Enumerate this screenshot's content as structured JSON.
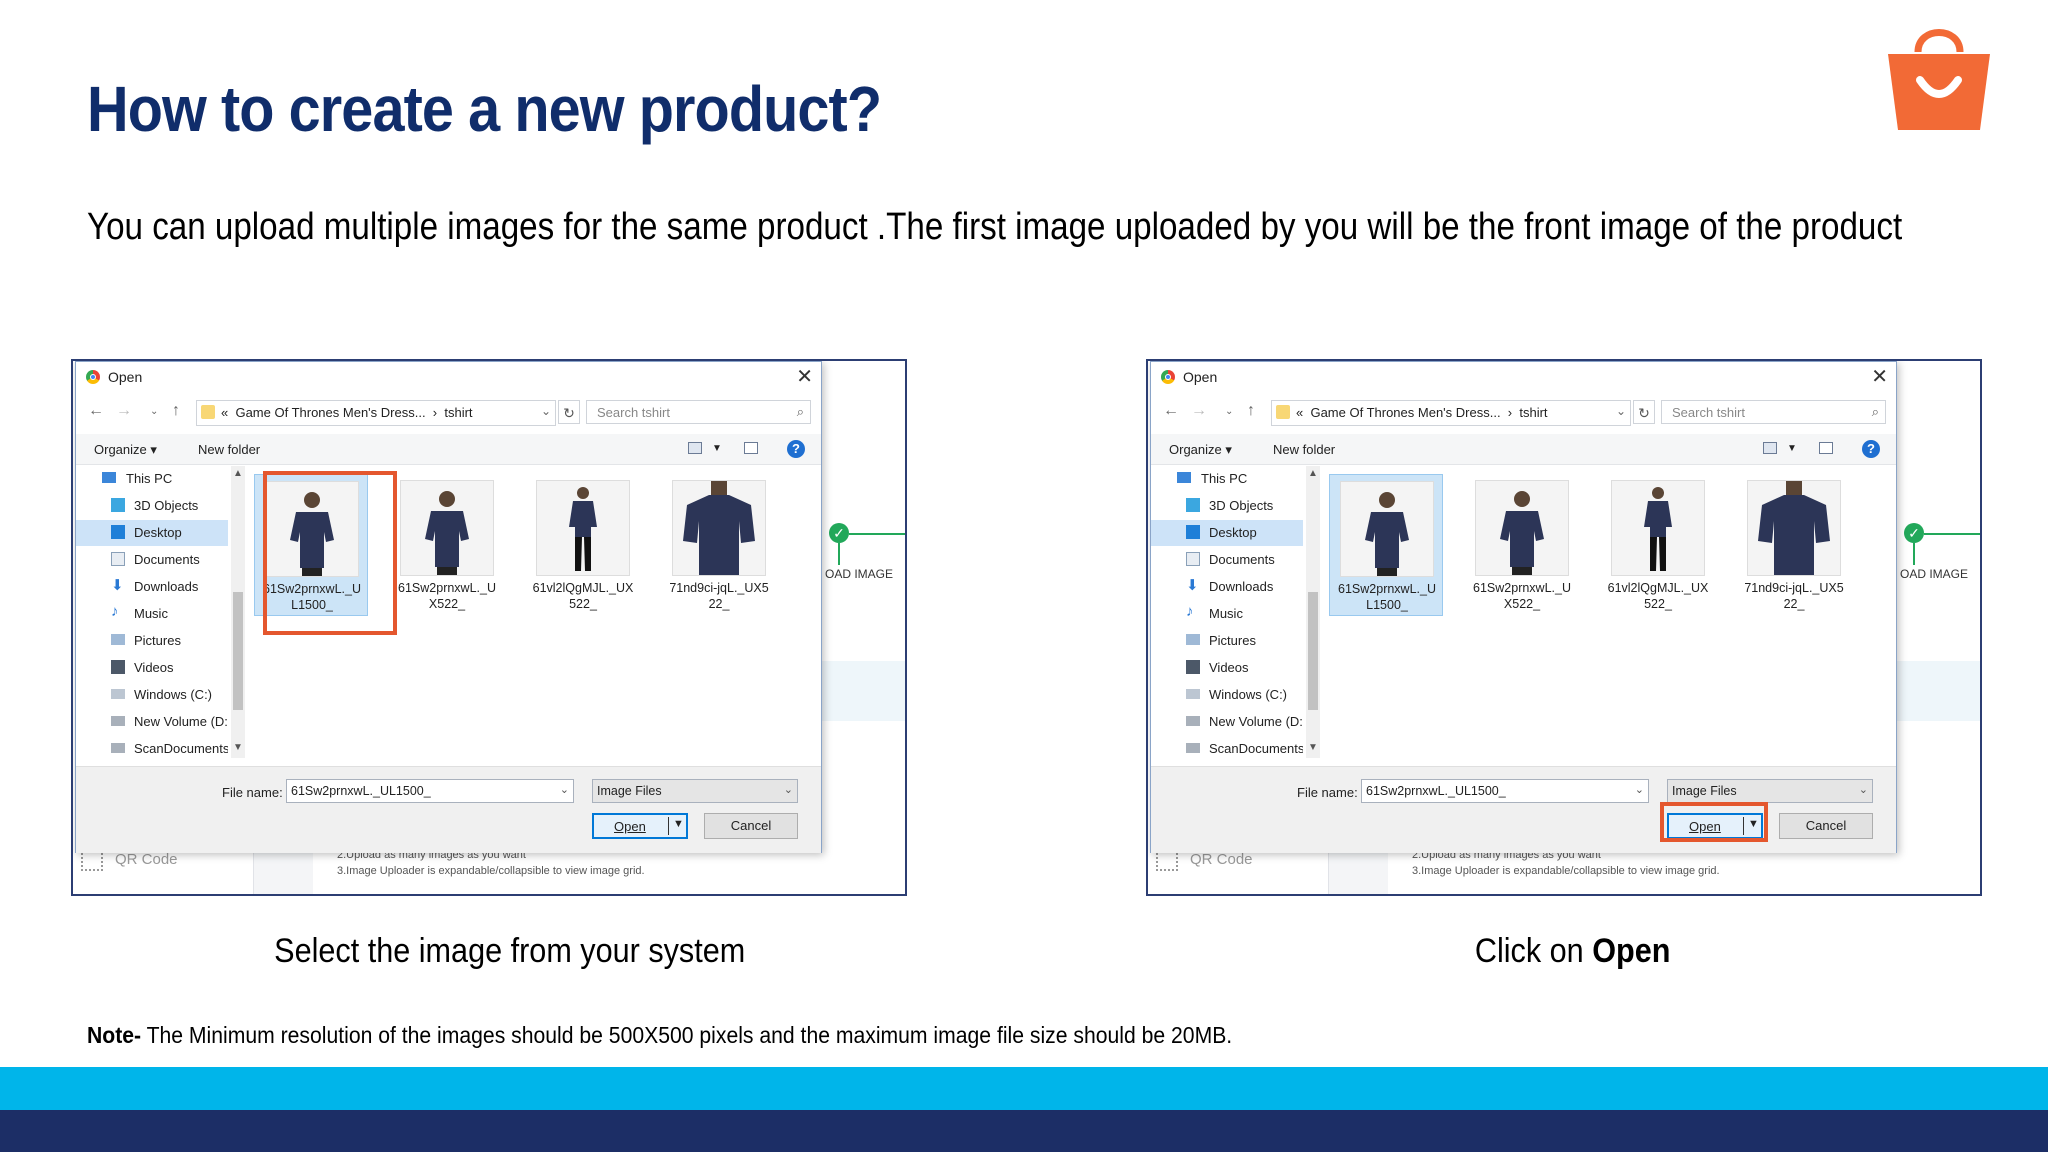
{
  "page": {
    "title": "How to create a new product?",
    "subtitle": "You can upload multiple images for the same product .The first image uploaded by you will be the front image of the product",
    "caption_left": "Select the image from your system",
    "caption_right_prefix": "Click on ",
    "caption_right_bold": "Open",
    "note_bold": "Note-",
    "note_text": " The Minimum resolution of the images should be 500X500 pixels and the maximum image file size should be 20MB.",
    "logo_icon": "shopping-bag-icon",
    "colors": {
      "title": "#102d6b",
      "accent_orange": "#f26a36",
      "band_light": "#00b5ea",
      "band_dark": "#1c2e66",
      "highlight": "#e4572e"
    }
  },
  "dialog": {
    "title": "Open",
    "path_prefix": "«",
    "path_folder": "Game Of Thrones Men's Dress...",
    "path_sep": "›",
    "path_sub": "tshirt",
    "search_placeholder": "Search tshirt",
    "organize": "Organize ▾",
    "new_folder": "New folder",
    "help": "?",
    "nav_items": [
      "This PC",
      "3D Objects",
      "Desktop",
      "Documents",
      "Downloads",
      "Music",
      "Pictures",
      "Videos",
      "Windows (C:)",
      "New Volume (D:",
      "ScanDocuments"
    ],
    "files": [
      {
        "name": "61Sw2prnxwL._UL1500_",
        "line1": "61Sw2prnxwL._U",
        "line2": "L1500_"
      },
      {
        "name": "61Sw2prnxwL._UX522_",
        "line1": "61Sw2prnxwL._U",
        "line2": "X522_"
      },
      {
        "name": "61vl2lQgMJL._UX522_",
        "line1": "61vl2lQgMJL._UX",
        "line2": "522_"
      },
      {
        "name": "71nd9ci-jqL._UX522_",
        "line1": "71nd9ci-jqL._UX5",
        "line2": "22_"
      }
    ],
    "file_name_label": "File name:",
    "file_name_label_right": "File name:",
    "file_name_value": "61Sw2prnxwL._UL1500_",
    "file_type": "Image Files",
    "open_btn": "Open",
    "cancel_btn": "Cancel"
  },
  "background_app": {
    "upload_label": "OAD IMAGE",
    "qr_label": "QR Code",
    "hint_line1": "2.Upload as many images as you want",
    "hint_line2": "3.Image Uploader is expandable/collapsible to view image grid."
  }
}
